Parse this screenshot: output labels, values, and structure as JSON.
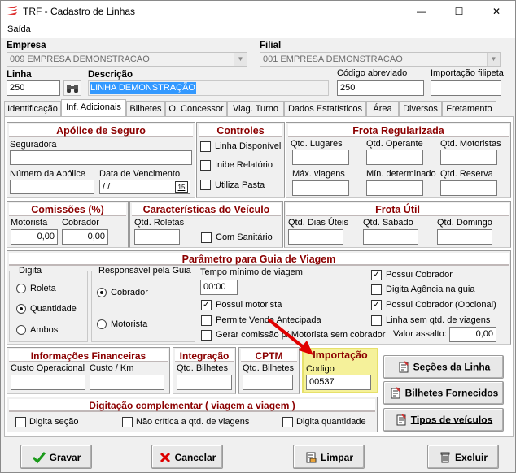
{
  "window": {
    "title": "TRF - Cadastro de Linhas",
    "minimize": "—",
    "maximize": "☐",
    "close": "✕"
  },
  "menu": {
    "saida": "Saída"
  },
  "header": {
    "empresa_label": "Empresa",
    "empresa_value": "009 EMPRESA DEMONSTRACAO",
    "filial_label": "Filial",
    "filial_value": "001 EMPRESA DEMONSTRACAO",
    "linha_label": "Linha",
    "linha_value": "250",
    "descricao_label": "Descrição",
    "descricao_value": "LINHA DEMONSTRAÇÃO",
    "codigo_abreviado_label": "Código abreviado",
    "codigo_abreviado_value": "250",
    "importacao_filipeta_label": "Importação filipeta",
    "importacao_filipeta_value": ""
  },
  "tabs": [
    "Identificação",
    "Inf. Adicionais",
    "Bilhetes",
    "O. Concessor",
    "Viag. Turno",
    "Dados Estatísticos",
    "Área",
    "Diversos",
    "Fretamento"
  ],
  "apolice": {
    "title": "Apólice de Seguro",
    "seguradora": "Seguradora",
    "seguradora_value": "",
    "numero": "Número da Apólice",
    "numero_value": "",
    "data": "Data de Vencimento",
    "data_value": " /  /",
    "cal": "15"
  },
  "controles": {
    "title": "Controles",
    "items": [
      "Linha Disponível",
      "Inibe Relatório",
      "Utiliza Pasta"
    ]
  },
  "frota_reg": {
    "title": "Frota Regularizada",
    "qtd_lugares": "Qtd. Lugares",
    "qtd_operante": "Qtd. Operante",
    "qtd_motoristas": "Qtd. Motoristas",
    "max_viagens": "Máx. viagens",
    "min_determinado": "Mín. determinado",
    "qtd_reserva": "Qtd. Reserva"
  },
  "comissoes": {
    "title": "Comissões (%)",
    "motorista": "Motorista",
    "motorista_value": "0,00",
    "cobrador": "Cobrador",
    "cobrador_value": "0,00"
  },
  "caracteristicas": {
    "title": "Características do Veículo",
    "qtd_roletas": "Qtd. Roletas",
    "com_sanitario": "Com Sanitário"
  },
  "frota_util": {
    "title": "Frota Útil",
    "dias_uteis": "Qtd. Dias Úteis",
    "sabado": "Qtd. Sabado",
    "domingo": "Qtd. Domingo"
  },
  "parametro": {
    "title": "Parâmetro para Guia de Viagem",
    "digita_title": "Digita",
    "digita_options": [
      "Roleta",
      "Quantidade",
      "Ambos"
    ],
    "digita_selected": 1,
    "responsavel_title": "Responsável pela Guia",
    "responsavel_options": [
      "Cobrador",
      "Motorista"
    ],
    "responsavel_selected": 0,
    "tempo_label": "Tempo mínimo de viagem",
    "tempo_value": "00:00",
    "possui_motorista": "Possui motorista",
    "possui_motorista_checked": true,
    "permite_venda": "Permite Venda Antecipada",
    "permite_venda_checked": false,
    "gerar_comissao": "Gerar comissão p/ Motorista sem cobrador",
    "gerar_comissao_checked": false,
    "possui_cobrador": "Possui Cobrador",
    "possui_cobrador_checked": true,
    "digita_agencia": "Digita Agência na guia",
    "digita_agencia_checked": false,
    "possui_cobrador_opcional": "Possui Cobrador (Opcional)",
    "possui_cobrador_opcional_checked": true,
    "linha_sem_qtd": "Linha sem  qtd. de viagens",
    "linha_sem_qtd_checked": false,
    "valor_assalto": "Valor assalto:",
    "valor_assalto_value": "0,00"
  },
  "info_fin": {
    "title": "Informações Financeiras",
    "custo_op": "Custo Operacional",
    "custo_km": "Custo / Km"
  },
  "integracao": {
    "title": "Integração",
    "qtd_bilhetes": "Qtd. Bilhetes"
  },
  "cptm": {
    "title": "CPTM",
    "qtd_bilhetes": "Qtd. Bilhetes"
  },
  "importacao": {
    "title": "Importação",
    "codigo": "Codigo",
    "codigo_value": "00537"
  },
  "digitacao": {
    "title": "Digitação complementar ( viagem a viagem )",
    "items": [
      "Digita seção",
      "Não crítica a qtd. de  viagens",
      "Digita quantidade"
    ]
  },
  "side_buttons": {
    "secoes": "Seções da Linha",
    "bilhetes": "Bilhetes Fornecidos",
    "tipos": "Tipos de veículos"
  },
  "footer": {
    "gravar": "Gravar",
    "cancelar": "Cancelar",
    "limpar": "Limpar",
    "excluir": "Excluir"
  },
  "colors": {
    "group_title": "#8b0000",
    "selection": "#3399ff",
    "highlight": "#f5f19a",
    "arrow": "#e00000"
  }
}
